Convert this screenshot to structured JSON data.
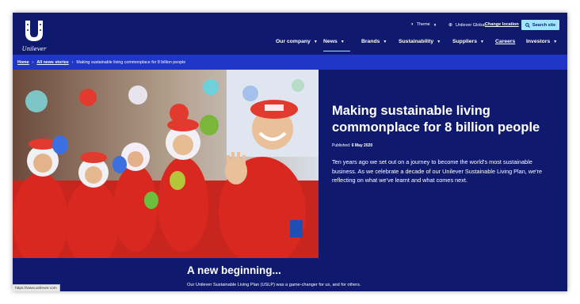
{
  "brand": {
    "name": "Unilever"
  },
  "utility": {
    "theme_label": "Theme",
    "location_label": "Unilever Global",
    "change_location": "Change location",
    "search_label": "Search site"
  },
  "nav": [
    {
      "label": "Our company",
      "has_menu": true
    },
    {
      "label": "News",
      "has_menu": true,
      "active": true
    },
    {
      "label": "Brands",
      "has_menu": true
    },
    {
      "label": "Sustainability",
      "has_menu": true
    },
    {
      "label": "Suppliers",
      "has_menu": true
    },
    {
      "label": "Careers",
      "has_menu": false
    },
    {
      "label": "Investors",
      "has_menu": true
    }
  ],
  "breadcrumb": {
    "home": "Home",
    "all_news": "All news stories",
    "current": "Making sustainable living commonplace for 8 billion people"
  },
  "hero": {
    "title": "Making sustainable living commonplace for 8 billion people",
    "published_label": "Published:",
    "published_date": "6 May 2020",
    "intro": "Ten years ago we set out on a journey to become the world's most sustainable business. As we celebrate a decade of our Unilever Sustainable Living Plan, we're reflecting on what we've learnt and what comes next."
  },
  "section": {
    "title": "A new beginning...",
    "text": "Our Unilever Sustainable Living Plan (USLP) was a game-changer for us, and for others."
  },
  "status_bar": {
    "url": "https://www.unilever.com"
  },
  "colors": {
    "navy": "#0f1a6e",
    "breadcrumb_blue": "#1f36c7",
    "accent_cyan": "#9ee6ff"
  }
}
